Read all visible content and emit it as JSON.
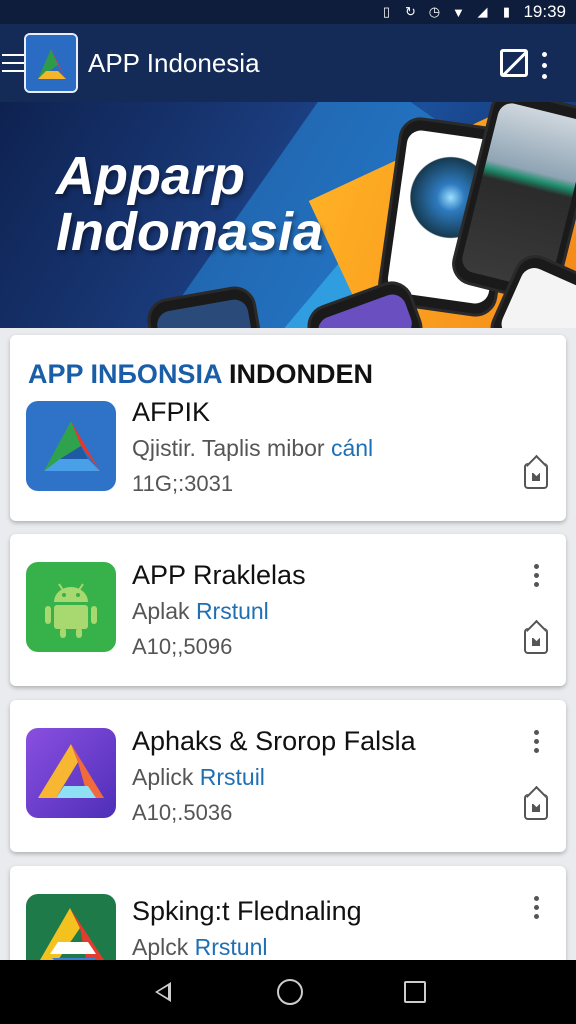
{
  "status_bar": {
    "time": "19:39",
    "icons": [
      "sim-icon",
      "sync-icon",
      "alarm-icon",
      "wifi-icon",
      "signal-icon",
      "battery-icon"
    ]
  },
  "app_bar": {
    "title": "APP Indonesia",
    "menu_icon": "hamburger-icon",
    "action_icon": "edit-icon",
    "overflow_icon": "more-vert-icon"
  },
  "hero": {
    "line1": "Apparp",
    "line2": "Indomasia"
  },
  "cards": [
    {
      "heading_blue": "APP INБONSIA",
      "heading_black": " INDONDEN",
      "name": "AFPIK",
      "sub_plain": "Qjistir. Taplis mibor ",
      "sub_highlight": "cánl",
      "code": "11G;:3031",
      "badge_icon": "home-badge-icon"
    },
    {
      "name": "APP Rraklelas",
      "sub_plain": "Aplak ",
      "sub_highlight": "Rrstunl",
      "code": "A10;,5096",
      "badge_icon": "home-badge-icon"
    },
    {
      "name": "Aphaks & Srorop Falsla",
      "sub_plain": "Aplick ",
      "sub_highlight": "Rrstuil",
      "code": "A10;.5036",
      "badge_icon": "home-badge-icon"
    },
    {
      "name": "Spking:t Flednaling",
      "sub_plain": "Aplck ",
      "sub_highlight": "Rrstunl"
    }
  ],
  "nav_bar": {
    "icons": [
      "back-icon",
      "home-icon",
      "recents-icon"
    ]
  },
  "colors": {
    "app_bar": "#142a57",
    "accent_blue": "#1f6fb5",
    "heading_blue": "#1b5ea8"
  }
}
